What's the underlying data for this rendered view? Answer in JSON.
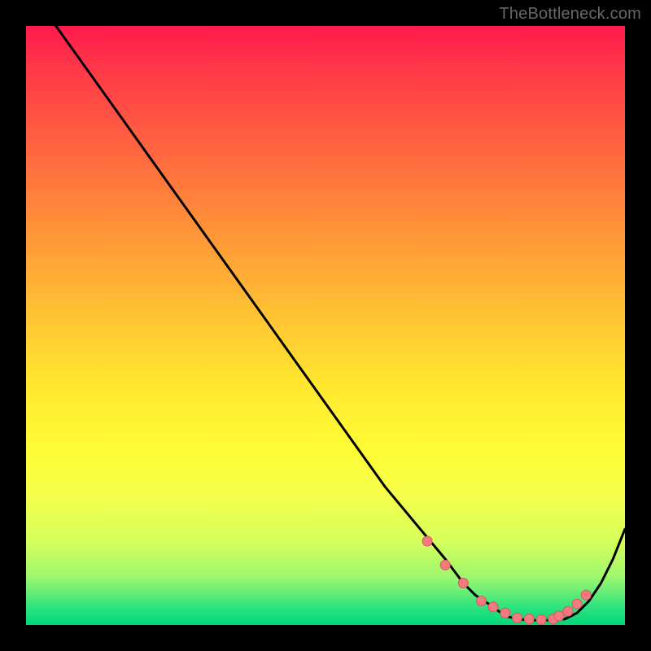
{
  "watermark": "TheBottleneck.com",
  "colors": {
    "curve_stroke": "#000000",
    "marker_fill": "#f57a80",
    "marker_stroke": "#d55a60"
  },
  "chart_data": {
    "type": "line",
    "title": "",
    "xlabel": "",
    "ylabel": "",
    "xlim": [
      0,
      100
    ],
    "ylim": [
      0,
      100
    ],
    "series": [
      {
        "name": "bottleneck-curve",
        "x": [
          0,
          5,
          10,
          15,
          20,
          25,
          30,
          35,
          40,
          45,
          50,
          55,
          60,
          65,
          70,
          73,
          75,
          78,
          80,
          82,
          84,
          86,
          88,
          90,
          92,
          94,
          96,
          98,
          100
        ],
        "y": [
          103,
          100,
          93,
          86,
          79,
          72,
          65,
          58,
          51,
          44,
          37,
          30,
          23,
          17,
          11,
          7,
          5,
          3,
          1.5,
          1,
          0.8,
          0.8,
          0.8,
          1,
          2,
          4,
          7,
          11,
          16
        ]
      }
    ],
    "markers": {
      "name": "highlighted-points",
      "x": [
        67,
        70,
        73,
        76,
        78,
        80,
        82,
        84,
        86,
        88,
        89,
        90.5,
        92,
        93.5
      ],
      "y": [
        14,
        10,
        7,
        4,
        3,
        2,
        1.2,
        1,
        0.9,
        1,
        1.5,
        2.3,
        3.5,
        5
      ]
    }
  }
}
